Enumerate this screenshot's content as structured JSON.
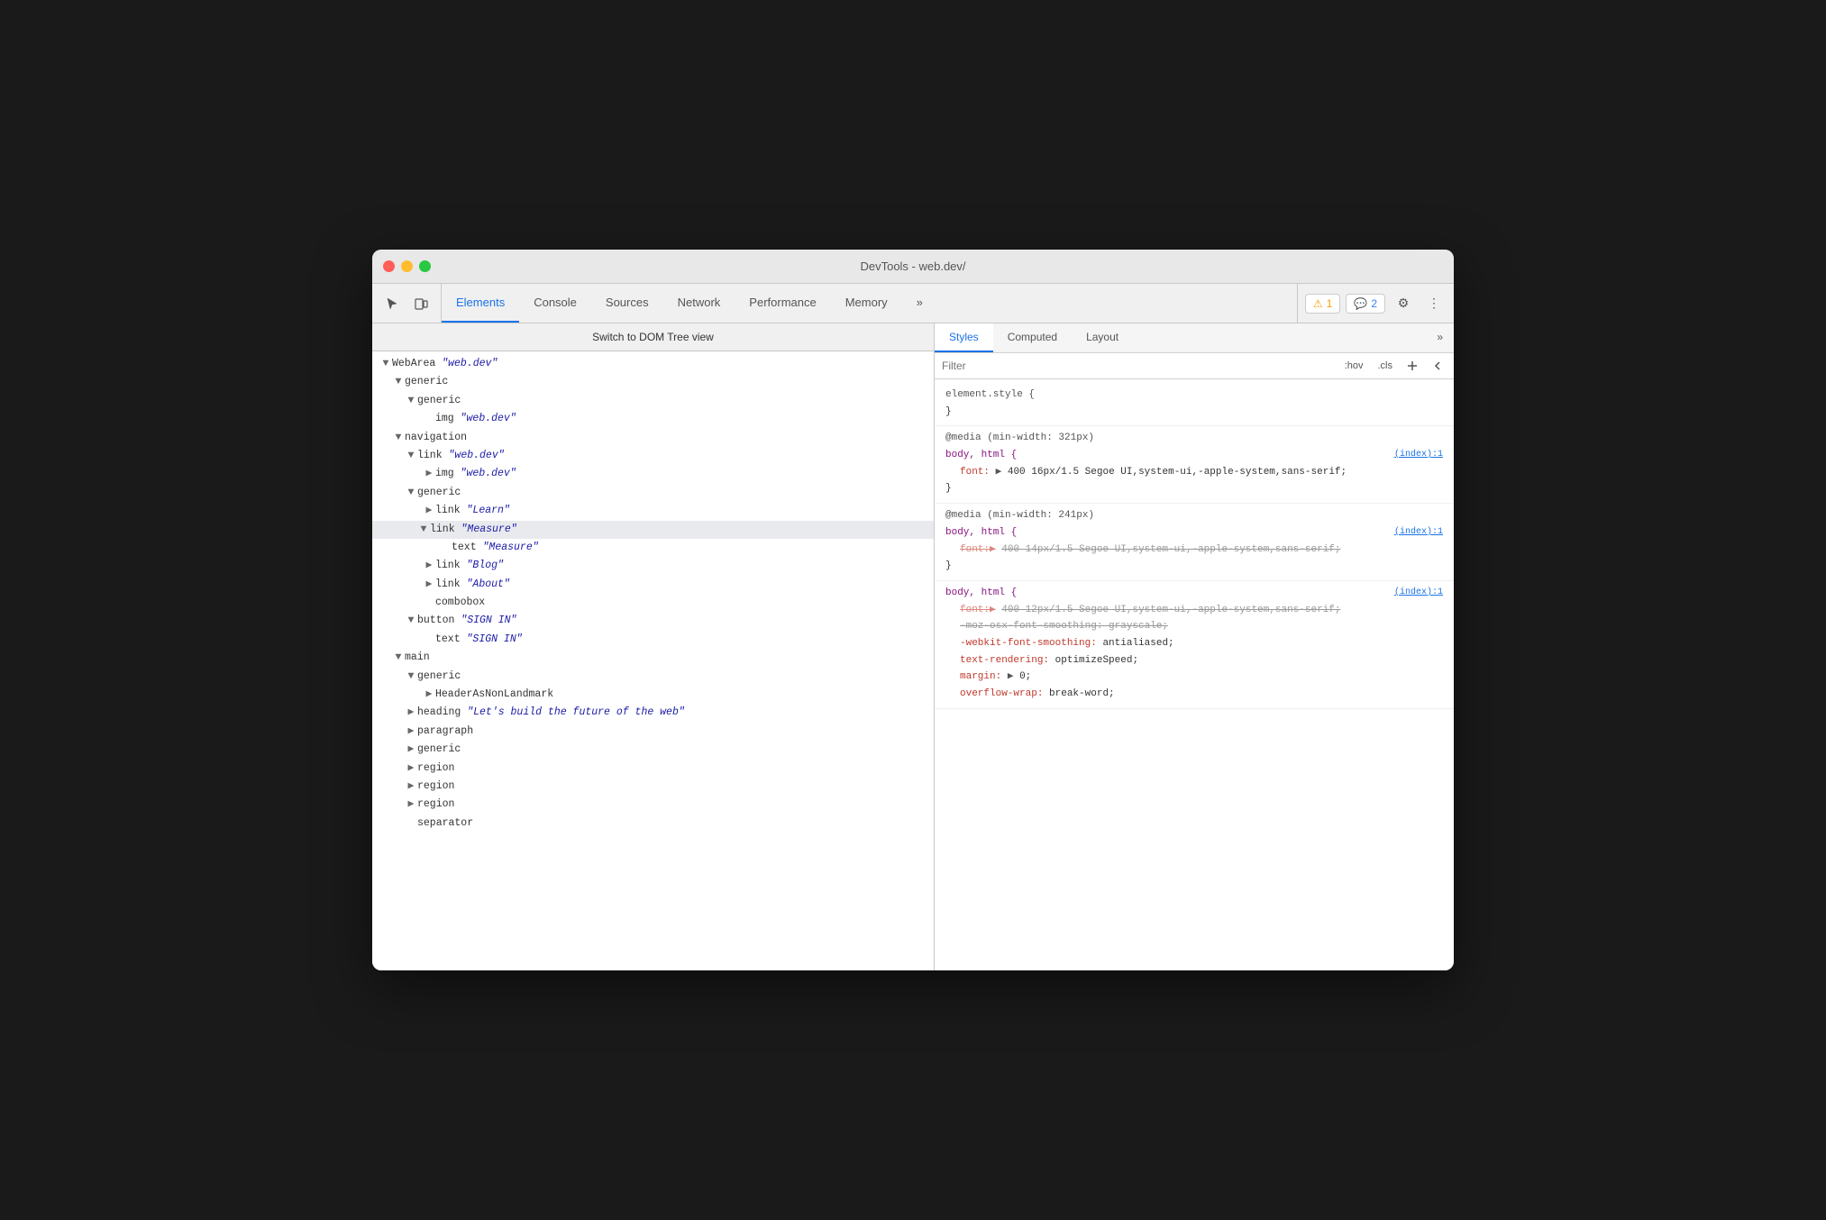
{
  "window": {
    "title": "DevTools - web.dev/"
  },
  "toolbar": {
    "tabs": [
      "Elements",
      "Console",
      "Sources",
      "Network",
      "Performance",
      "Memory"
    ],
    "active_tab": "Elements",
    "more_label": "»",
    "badge_warning": "1",
    "badge_info": "2",
    "icons": [
      "cursor-icon",
      "device-icon"
    ]
  },
  "dom_panel": {
    "switch_label": "Switch to DOM Tree view",
    "tree": []
  },
  "styles_panel": {
    "tabs": [
      "Styles",
      "Computed",
      "Layout"
    ],
    "active_tab": "Styles",
    "more_label": "»",
    "filter_placeholder": "Filter",
    "filter_actions": [
      ":hov",
      ".cls"
    ]
  }
}
